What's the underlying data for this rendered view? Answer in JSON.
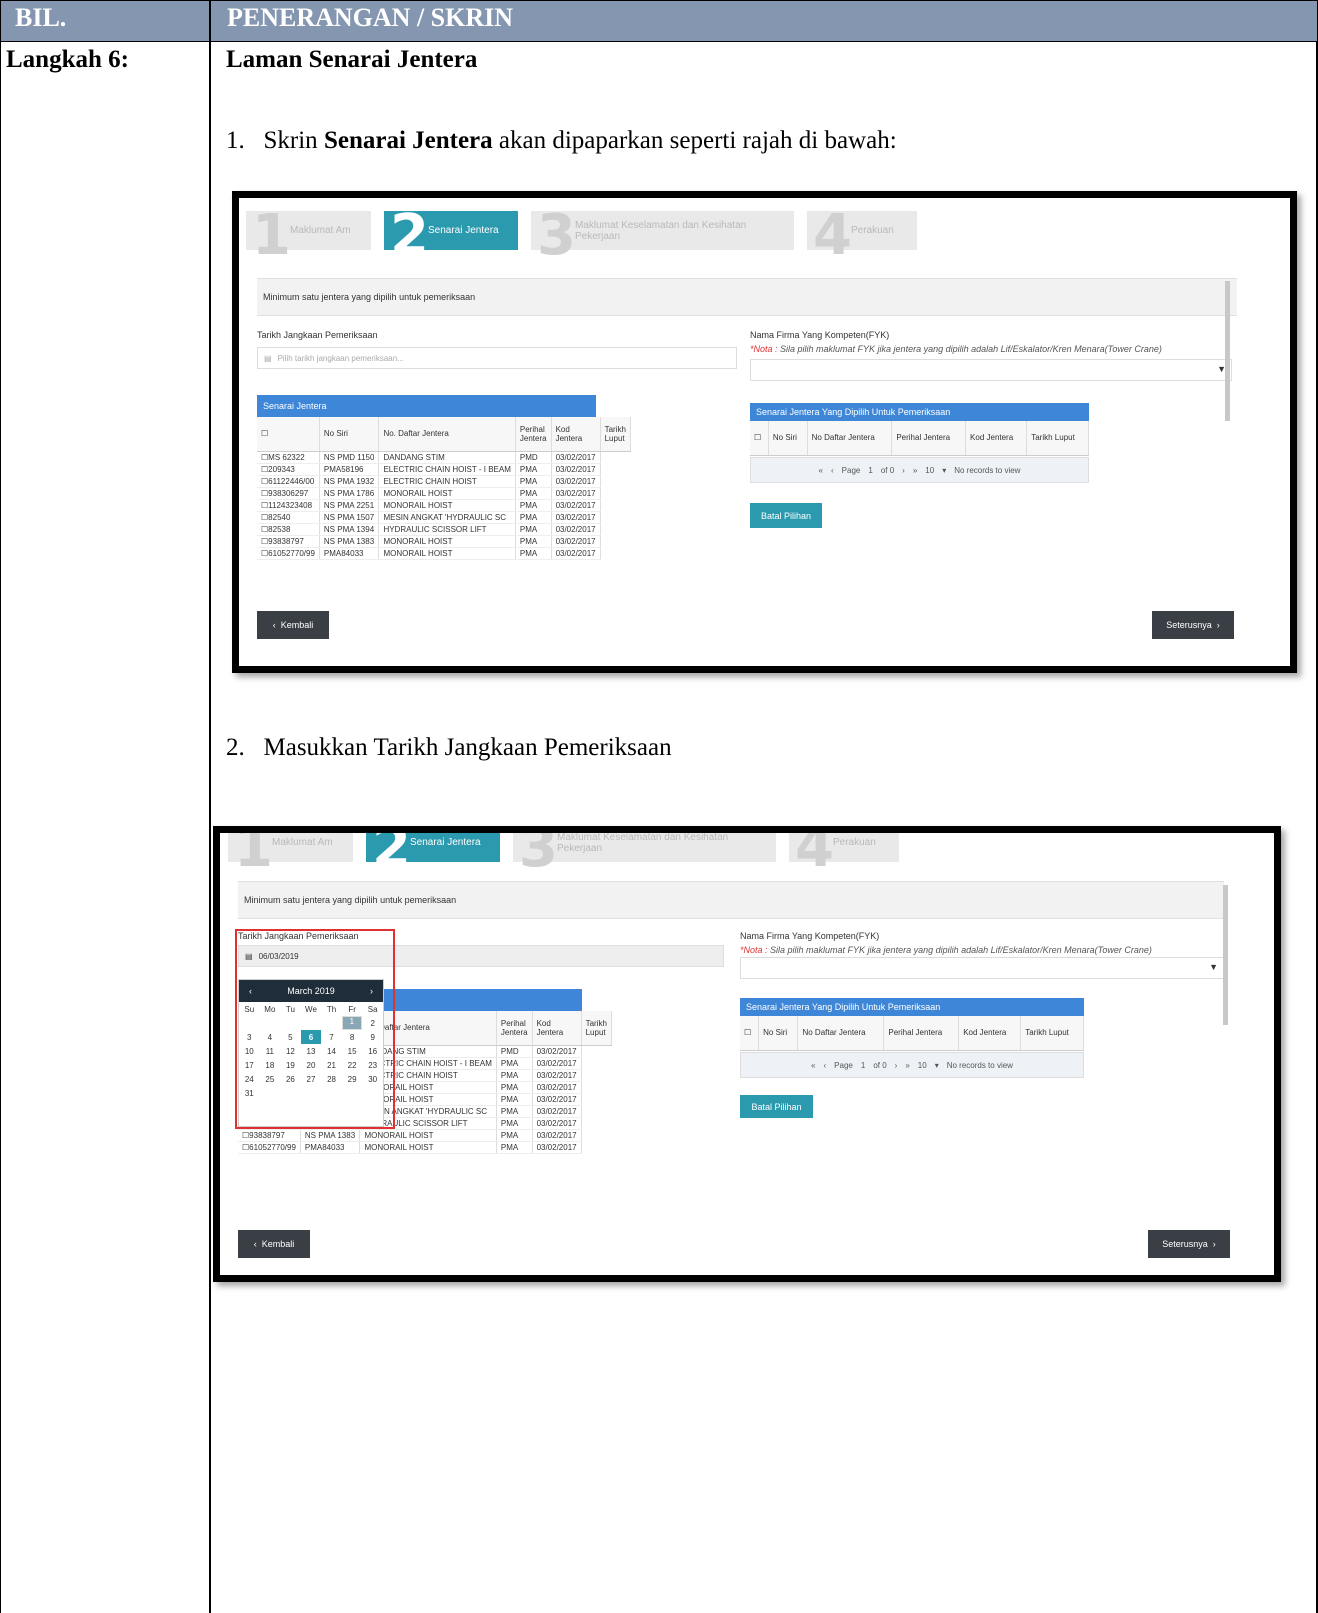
{
  "header": {
    "col1": "BIL.",
    "col2": "PENERANGAN / SKRIN"
  },
  "step_label": "Langkah 6:",
  "section_title": "Laman Senarai Jentera",
  "instructions": [
    {
      "num": "1.",
      "pre": "Skrin ",
      "bold": "Senarai Jentera",
      "post": " akan dipaparkan seperti rajah di bawah:"
    },
    {
      "num": "2.",
      "text": "Masukkan Tarikh Jangkaan Pemeriksaan"
    }
  ],
  "wizard_steps": [
    {
      "num": "1",
      "label": "Maklumat Am",
      "active": false
    },
    {
      "num": "2",
      "label": "Senarai Jentera",
      "active": true
    },
    {
      "num": "3",
      "label": "Maklumat Keselamatan dan Kesihatan Pekerjaan",
      "active": false
    },
    {
      "num": "4",
      "label": "Perakuan",
      "active": false
    }
  ],
  "screen": {
    "band_text": "Minimum satu jentera yang dipilih untuk pemeriksaan",
    "date_label": "Tarikh Jangkaan Pemeriksaan",
    "date_placeholder": "Pilih tarikh jangkaan pemeriksaan...",
    "date_value": "06/03/2019",
    "firm_label": "Nama Firma Yang Kompeten(FYK)",
    "nota_prefix": "*Nota :",
    "nota_text": " Sila pilih maklumat FYK jika jentera yang dipilih adalah Lif/Eskalator/Kren Menara(Tower Crane)",
    "list_title": "Senarai Jentera",
    "selected_title": "Senarai Jentera Yang Dipilih Untuk Pemeriksaan",
    "columns_left": [
      "No Siri",
      "No. Daftar Jentera",
      "Perihal Jentera",
      "Kod Jentera",
      "Tarikh Luput"
    ],
    "columns_right": [
      "No Siri",
      "No Daftar Jentera",
      "Perihal Jentera",
      "Kod Jentera",
      "Tarikh Luput"
    ],
    "rows": [
      [
        "MS 62322",
        "NS PMD 1150",
        "DANDANG STIM",
        "PMD",
        "03/02/2017"
      ],
      [
        "209343",
        "PMA58196",
        "ELECTRIC CHAIN HOIST - I BEAM",
        "PMA",
        "03/02/2017"
      ],
      [
        "61122446/00",
        "NS PMA 1932",
        "ELECTRIC CHAIN HOIST",
        "PMA",
        "03/02/2017"
      ],
      [
        "938306297",
        "NS PMA 1786",
        "MONORAIL HOIST",
        "PMA",
        "03/02/2017"
      ],
      [
        "1124323408",
        "NS PMA 2251",
        "MONORAIL HOIST",
        "PMA",
        "03/02/2017"
      ],
      [
        "82540",
        "NS PMA 1507",
        "MESIN ANGKAT 'HYDRAULIC SC",
        "PMA",
        "03/02/2017"
      ],
      [
        "82538",
        "NS PMA 1394",
        "HYDRAULIC SCISSOR LIFT",
        "PMA",
        "03/02/2017"
      ],
      [
        "93838797",
        "NS PMA 1383",
        "MONORAIL HOIST",
        "PMA",
        "03/02/2017"
      ],
      [
        "61052770/99",
        "PMA84033",
        "MONORAIL HOIST",
        "PMA",
        "03/02/2017"
      ]
    ],
    "pager": {
      "page_word": "Page",
      "page": "1",
      "of": "of 0",
      "size": "10",
      "empty": "No records to view"
    },
    "batal": "Batal Pilihan",
    "kembali": "Kembali",
    "seterusnya": "Seterusnya"
  },
  "calendar": {
    "month": "March 2019",
    "dow": [
      "Su",
      "Mo",
      "Tu",
      "We",
      "Th",
      "Fr",
      "Sa"
    ],
    "weeks": [
      [
        "",
        "",
        "",
        "",
        "",
        "1",
        "2"
      ],
      [
        "3",
        "4",
        "5",
        "6",
        "7",
        "8",
        "9"
      ],
      [
        "10",
        "11",
        "12",
        "13",
        "14",
        "15",
        "16"
      ],
      [
        "17",
        "18",
        "19",
        "20",
        "21",
        "22",
        "23"
      ],
      [
        "24",
        "25",
        "26",
        "27",
        "28",
        "29",
        "30"
      ],
      [
        "31",
        "",
        "",
        "",
        "",
        "",
        ""
      ]
    ],
    "selected_day": "6",
    "today_day": "1"
  }
}
